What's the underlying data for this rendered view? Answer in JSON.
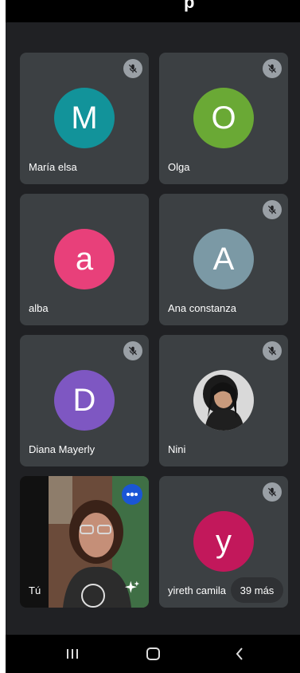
{
  "header": {
    "title_fragment": "p"
  },
  "participants": [
    {
      "name": "María elsa",
      "initial": "M",
      "color": "#12939a",
      "muted": true
    },
    {
      "name": "Olga",
      "initial": "O",
      "color": "#6aa935",
      "muted": true
    },
    {
      "name": "alba",
      "initial": "a",
      "color": "#e8407a",
      "muted": false
    },
    {
      "name": "Ana constanza",
      "initial": "A",
      "color": "#7b99a5",
      "muted": true
    },
    {
      "name": "Diana Mayerly",
      "initial": "D",
      "color": "#7e57c2",
      "muted": true
    },
    {
      "name": "Nini",
      "initial": "",
      "color": "#cfcfcf",
      "muted": true
    },
    {
      "name": "Tú",
      "initial": "",
      "color": "#111111",
      "muted": false
    },
    {
      "name": "yireth camila",
      "initial": "y",
      "color": "#c2185b",
      "muted": true
    }
  ],
  "more": {
    "label": "39 más"
  },
  "icons": {
    "mute": "mic-off-icon",
    "speaking": "audio-level-icon",
    "effects": "sparkle-icon",
    "nav_recent": "recent-apps-icon",
    "nav_home": "home-icon",
    "nav_back": "back-icon"
  }
}
